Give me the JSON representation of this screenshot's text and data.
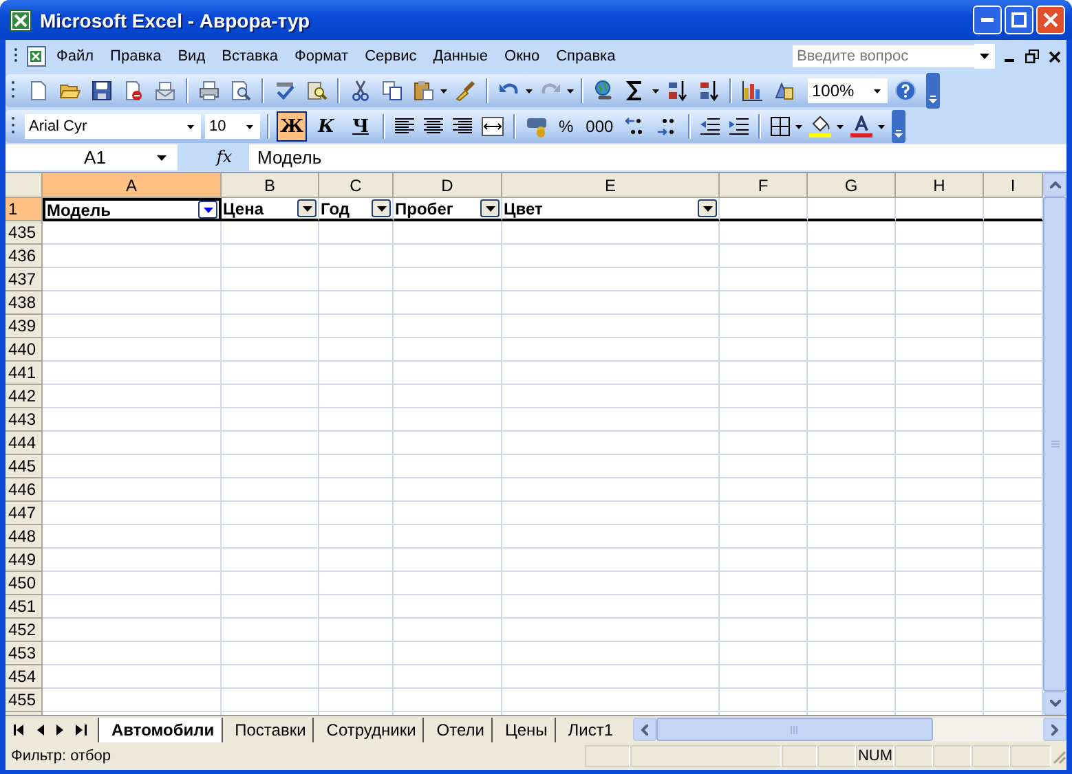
{
  "window": {
    "title": "Microsoft Excel - Аврора-тур"
  },
  "menu": {
    "items": [
      "Файл",
      "Правка",
      "Вид",
      "Вставка",
      "Формат",
      "Сервис",
      "Данные",
      "Окно",
      "Справка"
    ],
    "help_search": {
      "placeholder": "Введите вопрос"
    }
  },
  "standard_toolbar": {
    "zoom": "100%"
  },
  "formatting_toolbar": {
    "font": "Arial Cyr",
    "size": "10",
    "style_buttons": [
      {
        "label": "Ж",
        "kind": "bold",
        "selected": true
      },
      {
        "label": "К",
        "kind": "italic",
        "selected": false
      },
      {
        "label": "Ч",
        "kind": "underline",
        "selected": false
      }
    ],
    "number_buttons": [
      "%",
      "000"
    ]
  },
  "formula_bar": {
    "name_box": "A1",
    "function_label": "fx",
    "value": "Модель"
  },
  "sheet": {
    "columns": [
      {
        "label": "A",
        "selected": true
      },
      {
        "label": "B",
        "selected": false
      },
      {
        "label": "C",
        "selected": false
      },
      {
        "label": "D",
        "selected": false
      },
      {
        "label": "E",
        "selected": false
      },
      {
        "label": "F",
        "selected": false
      },
      {
        "label": "G",
        "selected": false
      },
      {
        "label": "H",
        "selected": false
      },
      {
        "label": "I",
        "selected": false
      }
    ],
    "header_row": {
      "label": "1",
      "selected": true,
      "cells": [
        {
          "text": "Модель",
          "filter_active": true
        },
        {
          "text": "Цена",
          "filter_active": false
        },
        {
          "text": "Год",
          "filter_active": false
        },
        {
          "text": "Пробег",
          "filter_active": false
        },
        {
          "text": "Цвет",
          "filter_active": false
        }
      ]
    },
    "rows": [
      "435",
      "436",
      "437",
      "438",
      "439",
      "440",
      "441",
      "442",
      "443",
      "444",
      "445",
      "446",
      "447",
      "448",
      "449",
      "450",
      "451",
      "452",
      "453",
      "454",
      "455"
    ]
  },
  "sheet_tabs": [
    {
      "label": "Автомобили",
      "selected": true
    },
    {
      "label": "Поставки",
      "selected": false
    },
    {
      "label": "Сотрудники",
      "selected": false
    },
    {
      "label": "Отели",
      "selected": false
    },
    {
      "label": "Цены",
      "selected": false
    },
    {
      "label": "Лист1",
      "selected": false
    }
  ],
  "status_bar": {
    "text": "Фильтр: отбор",
    "indicator": "NUM"
  }
}
